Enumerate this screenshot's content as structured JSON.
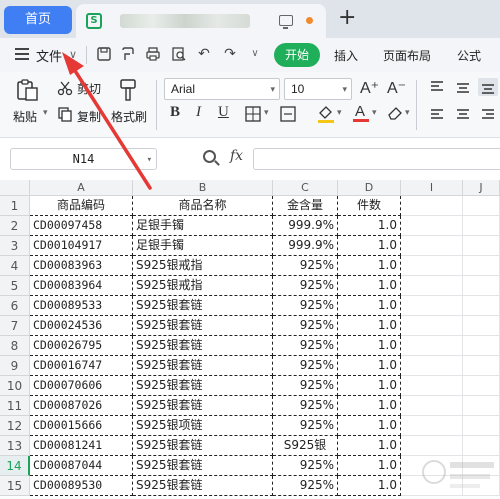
{
  "tabs": {
    "home_label": "首页",
    "doc_icon": "S"
  },
  "menu": {
    "file_label": "文件",
    "start_label": "开始",
    "items": [
      "插入",
      "页面布局",
      "公式"
    ]
  },
  "ribbon": {
    "paste_label": "粘贴",
    "cut_label": "剪切",
    "copy_label": "复制",
    "format_painter_label": "格式刷",
    "font_name": "Arial",
    "font_size": "10",
    "bold": "B",
    "italic": "I",
    "underline": "U",
    "grow_font": "A⁺",
    "shrink_font": "A⁻"
  },
  "formula_bar": {
    "cell_ref": "N14",
    "fx_label": "fx"
  },
  "sheet": {
    "columns": [
      "A",
      "B",
      "C",
      "D",
      "I",
      "J"
    ],
    "headers": [
      "商品编码",
      "商品名称",
      "金含量",
      "件数"
    ],
    "selected_row": 14,
    "rows": [
      {
        "num": "2",
        "code": "CD00097458",
        "name": "足银手镯",
        "gold": "999.9%",
        "qty": "1.0"
      },
      {
        "num": "3",
        "code": "CD00104917",
        "name": "足银手镯",
        "gold": "999.9%",
        "qty": "1.0"
      },
      {
        "num": "4",
        "code": "CD00083963",
        "name": "S925银戒指",
        "gold": "925%",
        "qty": "1.0"
      },
      {
        "num": "5",
        "code": "CD00083964",
        "name": "S925银戒指",
        "gold": "925%",
        "qty": "1.0"
      },
      {
        "num": "6",
        "code": "CD00089533",
        "name": "S925银套链",
        "gold": "925%",
        "qty": "1.0"
      },
      {
        "num": "7",
        "code": "CD00024536",
        "name": "S925银套链",
        "gold": "925%",
        "qty": "1.0"
      },
      {
        "num": "8",
        "code": "CD00026795",
        "name": "S925银套链",
        "gold": "925%",
        "qty": "1.0"
      },
      {
        "num": "9",
        "code": "CD00016747",
        "name": "S925银套链",
        "gold": "925%",
        "qty": "1.0"
      },
      {
        "num": "10",
        "code": "CD00070606",
        "name": "S925银套链",
        "gold": "925%",
        "qty": "1.0"
      },
      {
        "num": "11",
        "code": "CD00087026",
        "name": "S925银套链",
        "gold": "925%",
        "qty": "1.0"
      },
      {
        "num": "12",
        "code": "CD00015666",
        "name": "S925银项链",
        "gold": "925%",
        "qty": "1.0"
      },
      {
        "num": "13",
        "code": "CD00081241",
        "name": "S925银套链",
        "gold": "S925银",
        "qty": "1.0"
      },
      {
        "num": "14",
        "code": "CD00087044",
        "name": "S925银套链",
        "gold": "925%",
        "qty": "1.0"
      },
      {
        "num": "15",
        "code": "CD00089530",
        "name": "S925银套链",
        "gold": "925%",
        "qty": "1.0"
      }
    ]
  },
  "colors": {
    "accent_blue": "#3f7ef3",
    "accent_green": "#1fae59",
    "annotation_red": "#e53935"
  }
}
